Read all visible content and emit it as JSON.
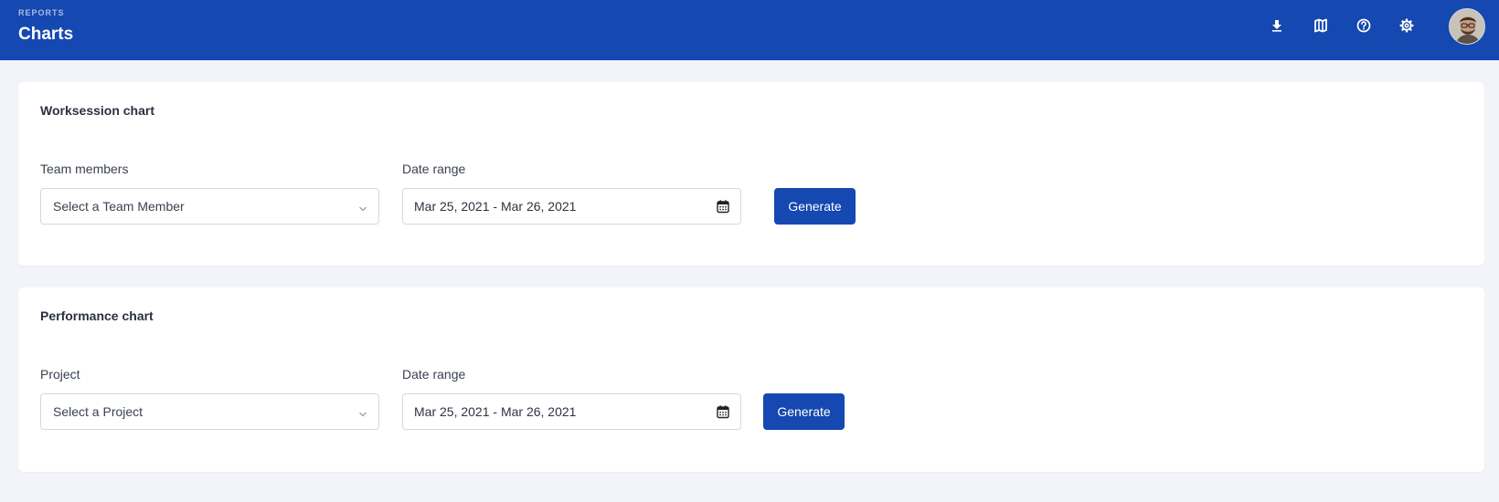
{
  "header": {
    "eyebrow": "REPORTS",
    "title": "Charts",
    "icons": [
      "download-icon",
      "map-icon",
      "help-icon",
      "settings-icon"
    ],
    "background": "#1548b0"
  },
  "cards": [
    {
      "title": "Worksession chart",
      "select_label": "Team members",
      "select_value": "Select a Team Member",
      "date_label": "Date range",
      "date_value": "Mar 25, 2021 - Mar 26, 2021",
      "button_label": "Generate"
    },
    {
      "title": "Performance chart",
      "select_label": "Project",
      "select_value": "Select a Project",
      "date_label": "Date range",
      "date_value": "Mar 25, 2021 - Mar 26, 2021",
      "button_label": "Generate"
    }
  ],
  "colors": {
    "accent": "#1548b0",
    "page_background": "#f3f4f9"
  }
}
